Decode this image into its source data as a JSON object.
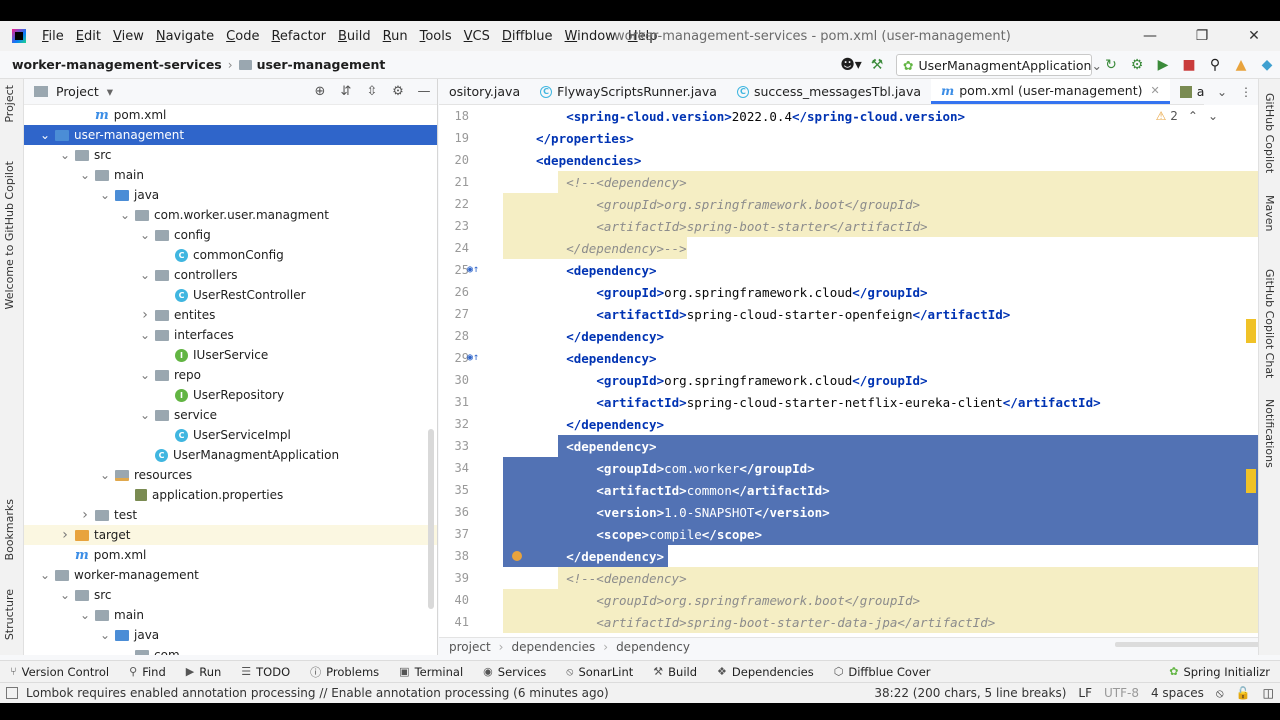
{
  "menu": [
    "File",
    "Edit",
    "View",
    "Navigate",
    "Code",
    "Refactor",
    "Build",
    "Run",
    "Tools",
    "VCS",
    "Diffblue",
    "Window",
    "Help"
  ],
  "window_title": "worker-management-services - pom.xml (user-management)",
  "nav": {
    "root": "worker-management-services",
    "module": "user-management",
    "run_config": "UserManagmentApplication"
  },
  "project_panel": {
    "title": "Project",
    "tree": [
      {
        "label": "pom.xml",
        "depth": 3,
        "icon": "maven",
        "chev": ""
      },
      {
        "label": "user-management",
        "depth": 1,
        "icon": "folder-blue",
        "chev": "down",
        "state": "selected"
      },
      {
        "label": "src",
        "depth": 2,
        "icon": "folder",
        "chev": "down"
      },
      {
        "label": "main",
        "depth": 3,
        "icon": "folder",
        "chev": "down"
      },
      {
        "label": "java",
        "depth": 4,
        "icon": "folder-blue",
        "chev": "down"
      },
      {
        "label": "com.worker.user.managment",
        "depth": 5,
        "icon": "folder",
        "chev": "down"
      },
      {
        "label": "config",
        "depth": 6,
        "icon": "folder",
        "chev": "down"
      },
      {
        "label": "commonConfig",
        "depth": 7,
        "icon": "class",
        "chev": ""
      },
      {
        "label": "controllers",
        "depth": 6,
        "icon": "folder",
        "chev": "down"
      },
      {
        "label": "UserRestController",
        "depth": 7,
        "icon": "class",
        "chev": ""
      },
      {
        "label": "entites",
        "depth": 6,
        "icon": "folder",
        "chev": "right"
      },
      {
        "label": "interfaces",
        "depth": 6,
        "icon": "folder",
        "chev": "down"
      },
      {
        "label": "IUserService",
        "depth": 7,
        "icon": "interface",
        "chev": ""
      },
      {
        "label": "repo",
        "depth": 6,
        "icon": "folder",
        "chev": "down"
      },
      {
        "label": "UserRepository",
        "depth": 7,
        "icon": "interface",
        "chev": ""
      },
      {
        "label": "service",
        "depth": 6,
        "icon": "folder",
        "chev": "down"
      },
      {
        "label": "UserServiceImpl",
        "depth": 7,
        "icon": "class",
        "chev": ""
      },
      {
        "label": "UserManagmentApplication",
        "depth": 6,
        "icon": "class",
        "chev": ""
      },
      {
        "label": "resources",
        "depth": 4,
        "icon": "folder-res",
        "chev": "down"
      },
      {
        "label": "application.properties",
        "depth": 5,
        "icon": "properties",
        "chev": ""
      },
      {
        "label": "test",
        "depth": 3,
        "icon": "folder",
        "chev": "right"
      },
      {
        "label": "target",
        "depth": 2,
        "icon": "folder-orange",
        "chev": "right",
        "state": "highlight"
      },
      {
        "label": "pom.xml",
        "depth": 2,
        "icon": "maven",
        "chev": ""
      },
      {
        "label": "worker-management",
        "depth": 1,
        "icon": "folder",
        "chev": "down"
      },
      {
        "label": "src",
        "depth": 2,
        "icon": "folder",
        "chev": "down"
      },
      {
        "label": "main",
        "depth": 3,
        "icon": "folder",
        "chev": "down"
      },
      {
        "label": "java",
        "depth": 4,
        "icon": "folder-blue",
        "chev": "down"
      },
      {
        "label": "com",
        "depth": 5,
        "icon": "folder",
        "chev": "down"
      }
    ]
  },
  "tabs": [
    {
      "label": "ository.java",
      "icon": "",
      "active": false
    },
    {
      "label": "FlywayScriptsRunner.java",
      "icon": "class",
      "active": false
    },
    {
      "label": "success_messagesTbl.java",
      "icon": "class",
      "active": false
    },
    {
      "label": "pom.xml (user-management)",
      "icon": "maven",
      "active": true
    },
    {
      "label": "application.prop",
      "icon": "properties",
      "active": false
    }
  ],
  "inspection": {
    "warnings": "2"
  },
  "code_lines": [
    {
      "n": "18",
      "indent": 2,
      "kind": "tagline",
      "open": "spring-cloud.version",
      "text": "2022.0.4",
      "close": "spring-cloud.version",
      "bg": ""
    },
    {
      "n": "19",
      "indent": 1,
      "kind": "close",
      "open": "",
      "text": "",
      "close": "properties",
      "bg": ""
    },
    {
      "n": "20",
      "indent": 1,
      "kind": "open",
      "open": "dependencies",
      "text": "",
      "close": "",
      "bg": ""
    },
    {
      "n": "21",
      "indent": 2,
      "kind": "comment",
      "text": "<!--<dependency>",
      "bg": "yellow-part"
    },
    {
      "n": "22",
      "indent": 3,
      "kind": "comment",
      "text": "<groupId>org.springframework.boot</groupId>",
      "bg": "yellow"
    },
    {
      "n": "23",
      "indent": 3,
      "kind": "comment",
      "text": "<artifactId>spring-boot-starter</artifactId>",
      "bg": "yellow"
    },
    {
      "n": "24",
      "indent": 2,
      "kind": "comment",
      "text": "</dependency>-->",
      "bg": "yellow-left"
    },
    {
      "n": "25",
      "indent": 2,
      "kind": "open",
      "open": "dependency",
      "text": "",
      "close": "",
      "bg": "",
      "gutter": "bean"
    },
    {
      "n": "26",
      "indent": 3,
      "kind": "tagline",
      "open": "groupId",
      "text": "org.springframework.cloud",
      "close": "groupId",
      "bg": ""
    },
    {
      "n": "27",
      "indent": 3,
      "kind": "tagline",
      "open": "artifactId",
      "text": "spring-cloud-starter-openfeign",
      "close": "artifactId",
      "bg": ""
    },
    {
      "n": "28",
      "indent": 2,
      "kind": "close",
      "open": "",
      "text": "",
      "close": "dependency",
      "bg": ""
    },
    {
      "n": "29",
      "indent": 2,
      "kind": "open",
      "open": "dependency",
      "text": "",
      "close": "",
      "bg": "",
      "gutter": "bean"
    },
    {
      "n": "30",
      "indent": 3,
      "kind": "tagline",
      "open": "groupId",
      "text": "org.springframework.cloud",
      "close": "groupId",
      "bg": ""
    },
    {
      "n": "31",
      "indent": 3,
      "kind": "tagline",
      "open": "artifactId",
      "text": "spring-cloud-starter-netflix-eureka-client",
      "close": "artifactId",
      "bg": ""
    },
    {
      "n": "32",
      "indent": 2,
      "kind": "close",
      "open": "",
      "text": "",
      "close": "dependency",
      "bg": ""
    },
    {
      "n": "33",
      "indent": 2,
      "kind": "open",
      "open": "dependency",
      "text": "",
      "close": "",
      "bg": "sel-part"
    },
    {
      "n": "34",
      "indent": 3,
      "kind": "tagline",
      "open": "groupId",
      "text": "com.worker",
      "close": "groupId",
      "bg": "sel"
    },
    {
      "n": "35",
      "indent": 3,
      "kind": "tagline",
      "open": "artifactId",
      "text": "common",
      "close": "artifactId",
      "bg": "sel"
    },
    {
      "n": "36",
      "indent": 3,
      "kind": "tagline",
      "open": "version",
      "text": "1.0-SNAPSHOT",
      "close": "version",
      "bg": "sel"
    },
    {
      "n": "37",
      "indent": 3,
      "kind": "tagline",
      "open": "scope",
      "text": "compile",
      "close": "scope",
      "bg": "sel"
    },
    {
      "n": "38",
      "indent": 2,
      "kind": "close",
      "open": "",
      "text": "",
      "close": "dependency",
      "bg": "sel-left",
      "gutter": "dot"
    },
    {
      "n": "39",
      "indent": 2,
      "kind": "comment",
      "text": "<!--<dependency>",
      "bg": "yellow-part"
    },
    {
      "n": "40",
      "indent": 3,
      "kind": "comment",
      "text": "<groupId>org.springframework.boot</groupId>",
      "bg": "yellow"
    },
    {
      "n": "41",
      "indent": 3,
      "kind": "comment",
      "text": "<artifactId>spring-boot-starter-data-jpa</artifactId>",
      "bg": "yellow"
    }
  ],
  "breadcrumbs": [
    "project",
    "dependencies",
    "dependency"
  ],
  "toolwindows": [
    "Version Control",
    "Find",
    "Run",
    "TODO",
    "Problems",
    "Terminal",
    "Services",
    "SonarLint",
    "Build",
    "Dependencies",
    "Diffblue Cover"
  ],
  "toolwindow_right": "Spring Initializr",
  "status": {
    "message": "Lombok requires enabled annotation processing // Enable annotation processing (6 minutes ago)",
    "position": "38:22 (200 chars, 5 line breaks)",
    "line_sep": "LF",
    "encoding": "UTF-8",
    "indent": "4 spaces"
  },
  "left_tabs": [
    "Project",
    "Welcome to GitHub Copilot",
    "Bookmarks",
    "Structure"
  ],
  "right_tabs": [
    "GitHub Copilot",
    "Maven",
    "GitHub Copilot Chat",
    "Notifications"
  ]
}
